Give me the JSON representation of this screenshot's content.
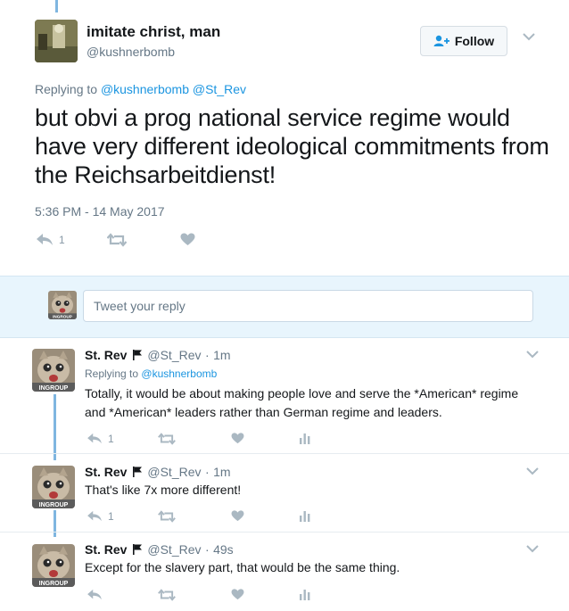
{
  "main_tweet": {
    "name": "imitate christ, man",
    "handle": "@kushnerbomb",
    "follow_label": "Follow",
    "replying_prefix": "Replying to",
    "replying_to": "@kushnerbomb @St_Rev",
    "text": "but obvi a prog national service regime would have very different ideological commitments from the Reichsarbeitdienst!",
    "timestamp": "5:36 PM - 14 May 2017",
    "reply_count": "1",
    "retweet_count": "",
    "like_count": ""
  },
  "reply_box": {
    "placeholder": "Tweet your reply",
    "avatar_badge": "INGROUP"
  },
  "replies": [
    {
      "name": "St. Rev",
      "handle": "@St_Rev",
      "time": "1m",
      "replying_prefix": "Replying to",
      "replying_to": "@kushnerbomb",
      "text": "Totally, it would be about making people love and serve the *American* regime and *American* leaders rather than German regime and leaders.",
      "reply_count": "1",
      "avatar_badge": "INGROUP"
    },
    {
      "name": "St. Rev",
      "handle": "@St_Rev",
      "time": "1m",
      "text": "That's like 7x more different!",
      "reply_count": "1",
      "avatar_badge": "INGROUP"
    },
    {
      "name": "St. Rev",
      "handle": "@St_Rev",
      "time": "49s",
      "text": "Except for the slavery part, that would be the same thing.",
      "reply_count": "",
      "avatar_badge": "INGROUP"
    }
  ],
  "icons": {
    "reply": "reply-icon",
    "retweet": "retweet-icon",
    "like": "heart-icon",
    "analytics": "analytics-icon",
    "more": "chevron-down-icon",
    "follow": "add-user-icon",
    "flag": "flag-icon"
  },
  "colors": {
    "accent": "#1b95e0",
    "text": "#14171a",
    "muted": "#657786",
    "icon": "#aab8c2",
    "thread": "#7fb6e0",
    "reply_bg": "#e8f5fd"
  }
}
